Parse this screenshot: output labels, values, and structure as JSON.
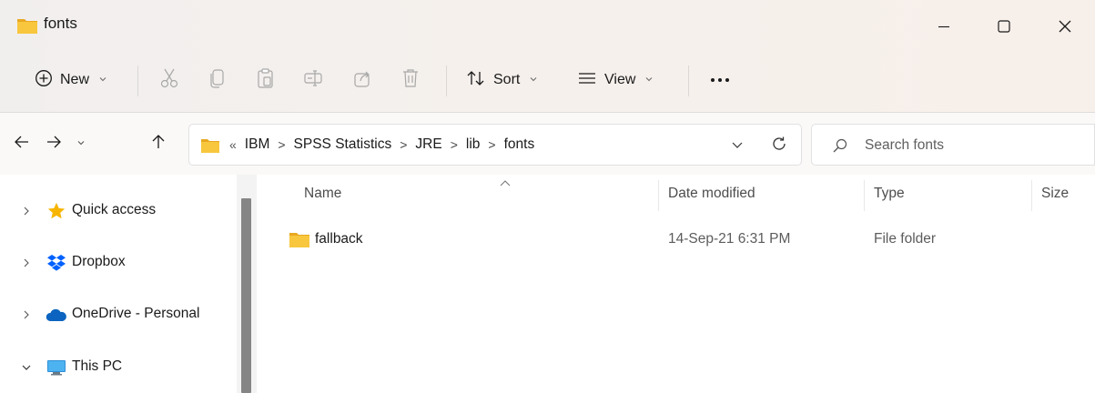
{
  "window": {
    "title": "fonts",
    "controls": {
      "minimize": "minimize-icon",
      "maximize": "maximize-icon",
      "close": "close-icon"
    }
  },
  "commandbar": {
    "new_label": "New",
    "sort_label": "Sort",
    "view_label": "View",
    "icons": [
      "plus-circle-icon",
      "cut-icon",
      "copy-icon",
      "paste-icon",
      "rename-icon",
      "share-icon",
      "delete-icon",
      "sort-icon",
      "view-icon",
      "more-icon"
    ]
  },
  "address": {
    "overflow": "«",
    "separator": ">",
    "crumbs": [
      "IBM",
      "SPSS Statistics",
      "JRE",
      "lib",
      "fonts"
    ]
  },
  "search": {
    "placeholder": "Search fonts"
  },
  "nav": {
    "items": [
      {
        "label": "Quick access",
        "expanded": false,
        "icon": "star-icon"
      },
      {
        "label": "Dropbox",
        "expanded": false,
        "icon": "dropbox-icon"
      },
      {
        "label": "OneDrive - Personal",
        "expanded": false,
        "icon": "onedrive-cloud-icon"
      },
      {
        "label": "This PC",
        "expanded": true,
        "icon": "computer-icon"
      }
    ]
  },
  "files": {
    "columns": {
      "name": "Name",
      "date": "Date modified",
      "type": "Type",
      "size": "Size"
    },
    "rows": [
      {
        "name": "fallback",
        "date": "14-Sep-21 6:31 PM",
        "type": "File folder"
      }
    ]
  },
  "colors": {
    "folder_yellow": "#f8c73e",
    "star_yellow": "#f7b500",
    "dropbox_blue": "#0061fe",
    "onedrive_blue": "#0c64c0",
    "accent": "#005fb8"
  }
}
